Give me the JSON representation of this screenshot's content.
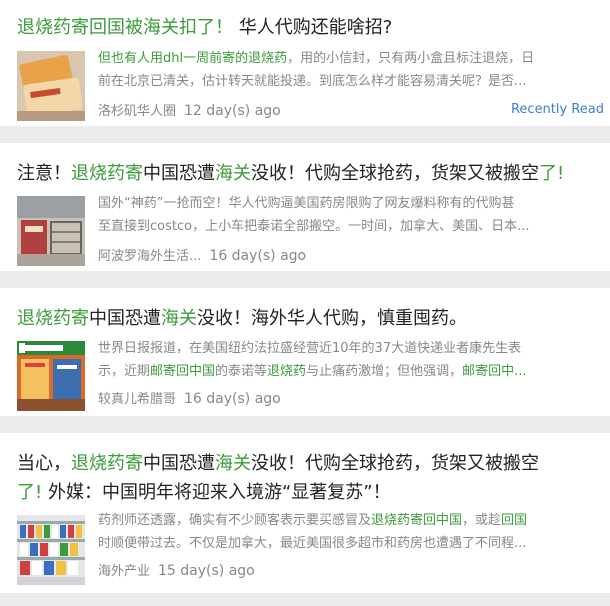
{
  "articles": [
    {
      "title_parts": [
        "退烧药寄回国被海关扣了！",
        " 华人代购还能啥招?"
      ],
      "snippet_line1_parts": [
        "但也有人用dhl一周前寄的退烧药",
        "，用的小信封，只有两小盒且标注退烧，日"
      ],
      "snippet_line2": "前在北京已清关，估计转天就能投递。到底怎么样才能容易清关呢？是否...",
      "source": "洛杉矶华人圈",
      "age": "12 day(s) ago",
      "recent_label": "Recently Read"
    },
    {
      "title_parts": [
        "注意！",
        "退烧药寄",
        "中国恐遭",
        "海关",
        "没收！代购全球抢药，货架又被搬空",
        "了!"
      ],
      "snippet_line1": "国外“神药”一抢而空！华人代购逼美国药房限购了网友爆料称有的代购甚",
      "snippet_line2": "至直接到costco，上小车把泰诺全部搬空。一时间，加拿大、美国、日本...",
      "source": "阿波罗海外生活...",
      "age": "16 day(s) ago"
    },
    {
      "title_parts": [
        "退烧药寄",
        "中国恐遭",
        "海关",
        "没收！海外华人代购，慎重囤药。"
      ],
      "snippet_line1": "世界日报报道，在美国纽约法拉盛经营近10年的37大道快递业者康先生表",
      "snippet_line2_parts": [
        "示，近期",
        "邮寄回中国",
        "的泰诺等",
        "退烧药",
        "与止痛药激增；但他强调，",
        "邮寄回中..."
      ],
      "source": "较真儿希腊哥",
      "age": "16 day(s) ago"
    },
    {
      "title_line1_parts": [
        "当心，",
        "退烧药寄",
        "中国恐遭",
        "海关",
        "没收！代购全球抢药，货架又被搬空"
      ],
      "title_line2_parts": [
        "了!",
        " 外媒：中国明年将迎来入境游“显著复苏”！"
      ],
      "snippet_line1_parts": [
        "药剂师还透露，确实有不少顾客表示要买感冒及",
        "退烧药寄回中国",
        "，或趁",
        "回国"
      ],
      "snippet_line2": "时顺便带过去。不仅是加拿大，最近美国很多超市和药房也遭遇了不同程...",
      "source": "海外产业",
      "age": "15 day(s) ago"
    }
  ]
}
